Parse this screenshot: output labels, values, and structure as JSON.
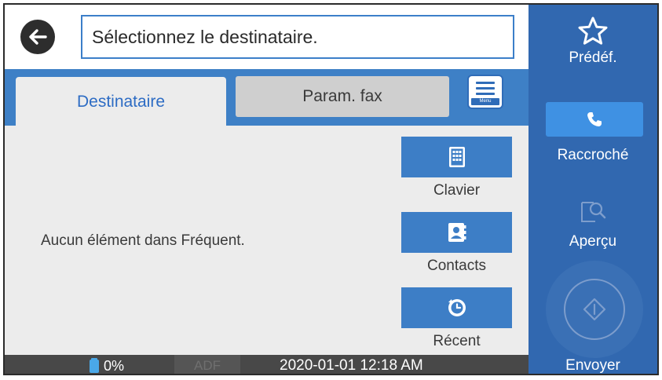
{
  "top_bar": {
    "back_icon": "arrow-left-icon",
    "recipient_prompt": "Sélectionnez le destinataire."
  },
  "tabs": [
    {
      "label": "Destinataire",
      "active": true
    },
    {
      "label": "Param. fax",
      "active": false
    }
  ],
  "menu_button": {
    "icon": "menu-icon",
    "label": "Menu"
  },
  "frequent": {
    "empty_message": "Aucun élément dans Fréquent."
  },
  "quick_buttons": [
    {
      "label": "Clavier",
      "icon": "keypad-icon"
    },
    {
      "label": "Contacts",
      "icon": "contacts-icon"
    },
    {
      "label": "Récent",
      "icon": "recent-icon"
    }
  ],
  "status_bar": {
    "ink_level": "0%",
    "adf_label": "ADF",
    "datetime": "2020-01-01 12:18 AM"
  },
  "right_panel": {
    "preset": {
      "label": "Prédéf.",
      "icon": "star-icon"
    },
    "hangup": {
      "label": "Raccroché",
      "icon": "phone-icon"
    },
    "preview": {
      "label": "Aperçu",
      "icon": "preview-icon"
    },
    "send": {
      "label": "Envoyer",
      "icon": "start-icon"
    }
  },
  "colors": {
    "accent_blue": "#3e80c6",
    "panel_blue": "#3168b0",
    "hangup_blue": "#3f91e3",
    "status_bar": "#484848"
  }
}
